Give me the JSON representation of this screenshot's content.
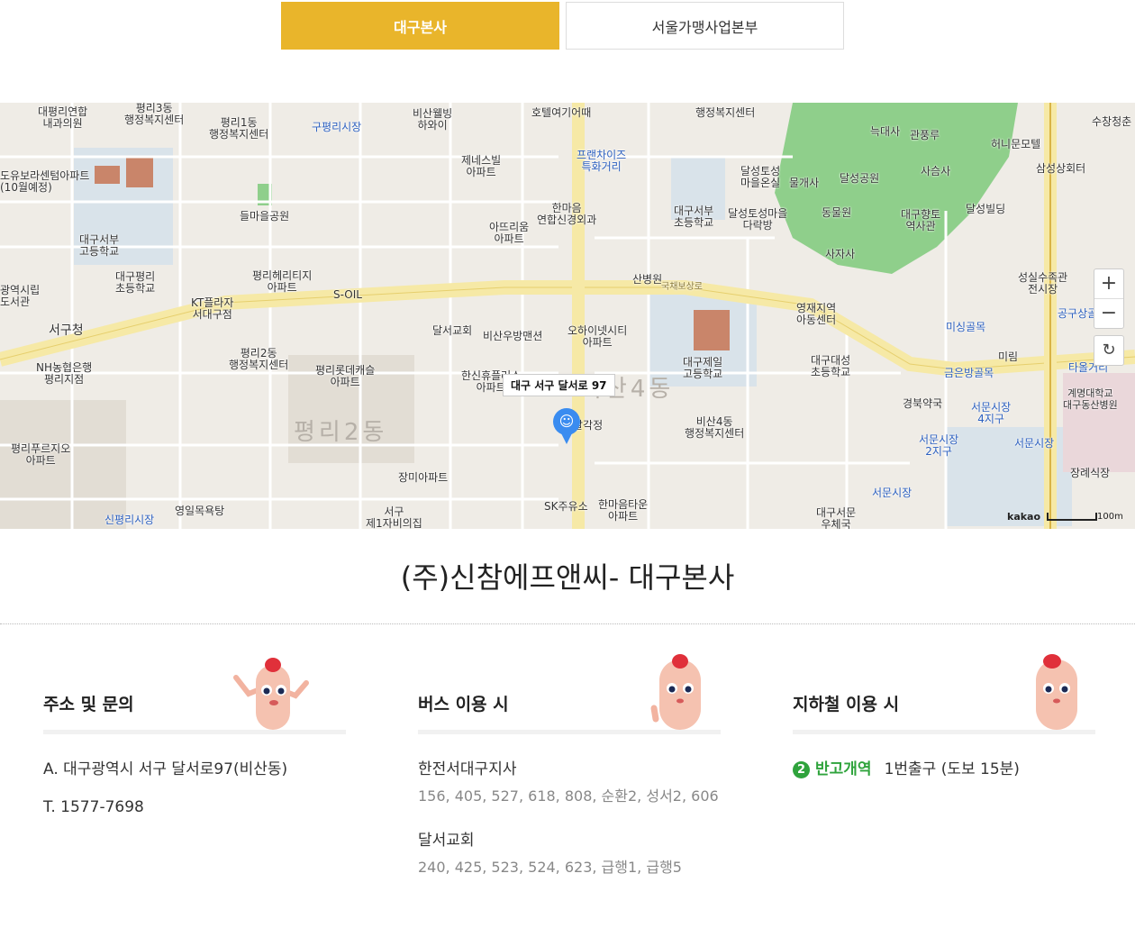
{
  "tabs": [
    {
      "label": "대구본사",
      "active": true
    },
    {
      "label": "서울가맹사업본부",
      "active": false
    }
  ],
  "map": {
    "pin_label": "대구 서구 달서로 97",
    "zoom_in": "+",
    "zoom_out": "−",
    "refresh": "↻",
    "attribution": "kakao",
    "scale": "100m",
    "labels": {
      "l1": "대평리연합\n내과의원",
      "l2": "평리3동\n행정복지센터",
      "l3": "평리1동\n행정복지센터",
      "l4": "구평리시장",
      "l5": "비산웰빙\n하와이",
      "l6": "호텔여기어때",
      "l7": "행정복지센터",
      "l8": "도유보라센텀아파트\n(10월예정)",
      "l9": "제네스빌\n아파트",
      "l10": "프랜차이즈\n특화거리",
      "l11": "달성토성\n마을온실",
      "l12": "물개사",
      "l13": "늑대사",
      "l14": "관풍루",
      "l15": "허니문모텔",
      "l16": "삼성상회터",
      "l17": "수창청춘",
      "l18": "들마을공원",
      "l19": "한마음\n연합신경외과",
      "l20": "아뜨리움\n아파트",
      "l21": "대구서부\n초등학교",
      "l22": "달성토성마을\n다락방",
      "l23": "동물원",
      "l24": "달성공원",
      "l25": "사슴사",
      "l26": "대구향토\n역사관",
      "l27": "달성빌딩",
      "l28": "대구서부\n고등학교",
      "l29": "대구평리\n초등학교",
      "l30": "평리헤리티지\n아파트",
      "l31": "S-OIL",
      "l32": "광역시립\n도서관",
      "l33": "KT플라자\n서대구점",
      "l34": "사자사",
      "l35": "국채보상로",
      "l36": "성실수족관\n전시장",
      "l37": "서구청",
      "l38": "평리2동\n행정복지센터",
      "l39": "달서교회",
      "l40": "비산우방맨션",
      "l41": "오하이넷시티\n아파트",
      "l42": "영재지역\n아동센터",
      "l43": "미싱골목",
      "l44": "공구상골",
      "l45": "NH농협은행\n평리지점",
      "l46": "평리롯데캐슬\n아파트",
      "l47": "한신휴플러스\n아파트",
      "l48": "대구제일\n고등학교",
      "l49": "대구대성\n초등학교",
      "l50": "미림",
      "l51": "금은방골목",
      "l52": "타올거리",
      "l53": "경북약국",
      "l54": "서문시장\n4지구",
      "l55": "계명대학교\n대구동산병원",
      "l56": "비산4동",
      "l57": "팔각정",
      "l58": "비산4동\n행정복지센터",
      "l59": "평리2동",
      "l60": "평리푸르지오\n아파트",
      "l61": "서문시장\n2지구",
      "l62": "서문시장",
      "l63": "장미아파트",
      "l64": "장례식장",
      "l65": "서구\n제1자비의집",
      "l66": "SK주유소",
      "l67": "한마음타운\n아파트",
      "l68": "서문시장",
      "l69": "영일목욕탕",
      "l70": "신평리시장",
      "l71": "대구서문\n우체국",
      "l72": "산병원"
    }
  },
  "title": "(주)신참에프앤씨- 대구본사",
  "columns": {
    "address": {
      "heading": "주소 및 문의",
      "address_line": "A. 대구광역시 서구 달서로97(비산동)",
      "phone_line": "T. 1577-7698"
    },
    "bus": {
      "heading": "버스 이용 시",
      "stops": [
        {
          "name": "한전서대구지사",
          "routes": "156, 405, 527, 618, 808, 순환2, 성서2, 606"
        },
        {
          "name": "달서교회",
          "routes": "240, 425, 523, 524, 623, 급행1, 급행5"
        }
      ]
    },
    "subway": {
      "heading": "지하철 이용 시",
      "line_number": "2",
      "station": "반고개역",
      "exit_info": "1번출구 (도보 15분)"
    }
  },
  "colors": {
    "accent": "#e9b52b",
    "subway_line2": "#2fa33c",
    "pin": "#3a8cf0",
    "park": "#8fcf8b"
  }
}
